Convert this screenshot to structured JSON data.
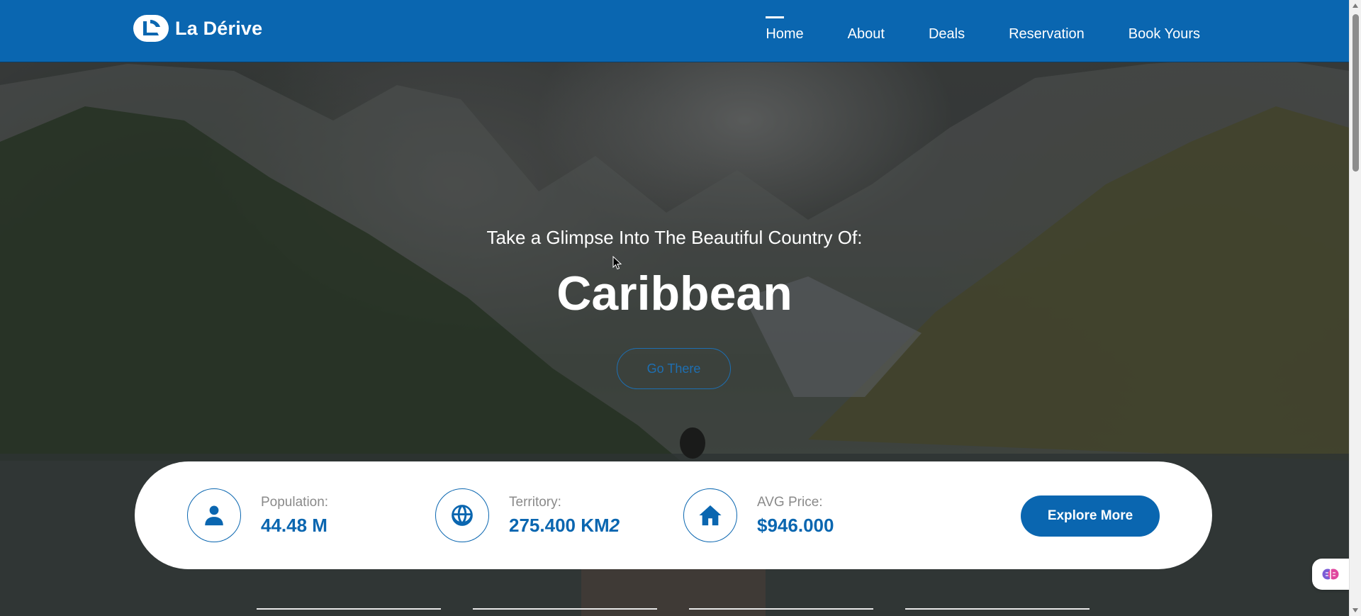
{
  "brand": {
    "name": "La Dérive"
  },
  "nav": {
    "items": [
      {
        "label": "Home",
        "active": true
      },
      {
        "label": "About",
        "active": false
      },
      {
        "label": "Deals",
        "active": false
      },
      {
        "label": "Reservation",
        "active": false
      },
      {
        "label": "Book Yours",
        "active": false
      }
    ]
  },
  "hero": {
    "subtitle": "Take a Glimpse Into The Beautiful Country Of:",
    "title": "Caribbean",
    "cta_label": "Go There"
  },
  "stats": {
    "items": [
      {
        "icon": "user-icon",
        "label": "Population:",
        "value": "44.48 M"
      },
      {
        "icon": "globe-icon",
        "label": "Territory:",
        "value": "275.400 KM",
        "suffix": "2"
      },
      {
        "icon": "house-icon",
        "label": "AVG Price:",
        "value": "$946.000"
      }
    ],
    "explore_label": "Explore More"
  },
  "colors": {
    "primary": "#0a66b0",
    "header_bg": "#0a66b0",
    "label_gray": "#8a8a8a",
    "white": "#ffffff"
  }
}
